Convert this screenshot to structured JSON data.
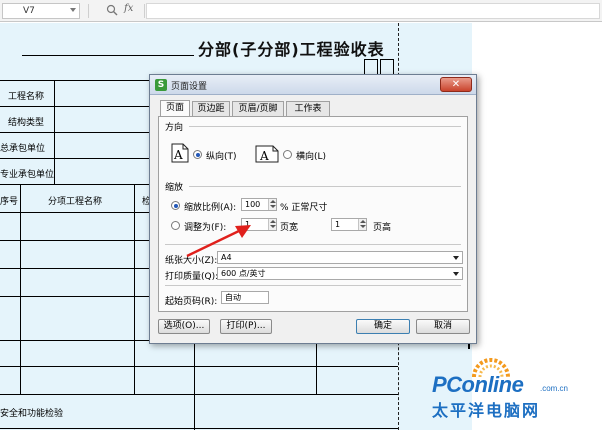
{
  "formula_bar": {
    "cell_ref": "V7",
    "fx_label": "fx"
  },
  "sheet": {
    "title": "分部(子分部)工程验收表",
    "row_labels": [
      "工程名称",
      "结构类型",
      "总承包单位",
      "专业承包单位"
    ],
    "header_cells": [
      "序号",
      "分项工程名称",
      "检"
    ],
    "footer_label": "安全和功能检验"
  },
  "dialog": {
    "title": "页面设置",
    "tabs": [
      {
        "label": "页面"
      },
      {
        "label": "页边距"
      },
      {
        "label": "页眉/页脚"
      },
      {
        "label": "工作表"
      }
    ],
    "orientation": {
      "group_label": "方向",
      "portrait_label": "纵向(T)",
      "landscape_label": "横向(L)",
      "selected": "portrait"
    },
    "scaling": {
      "group_label": "缩放",
      "scale_label": "缩放比例(A):",
      "scale_value": "100",
      "scale_suffix": "% 正常尺寸",
      "fit_label": "调整为(F):",
      "fit_wide_value": "1",
      "fit_wide_suffix": "页宽",
      "fit_tall_value": "1",
      "fit_tall_suffix": "页高",
      "selected": "scale"
    },
    "paper_size": {
      "label": "纸张大小(Z):",
      "value": "A4"
    },
    "print_quality": {
      "label": "打印质量(Q):",
      "value": "600 点/英寸"
    },
    "first_page": {
      "label": "起始页码(R):",
      "value": "自动"
    },
    "buttons": {
      "options": "选项(O)...",
      "print": "打印(P)...",
      "ok": "确定",
      "cancel": "取消"
    },
    "close_glyph": "✕",
    "app_icon_glyph": "S"
  },
  "watermark": {
    "brand": "PConline",
    "domain": ".com.cn",
    "chinese": "太平洋电脑网"
  },
  "colors": {
    "watermark": "#1d6fc2",
    "arrow": "#e0201c",
    "sheet_shade": "#e5f4fb"
  }
}
